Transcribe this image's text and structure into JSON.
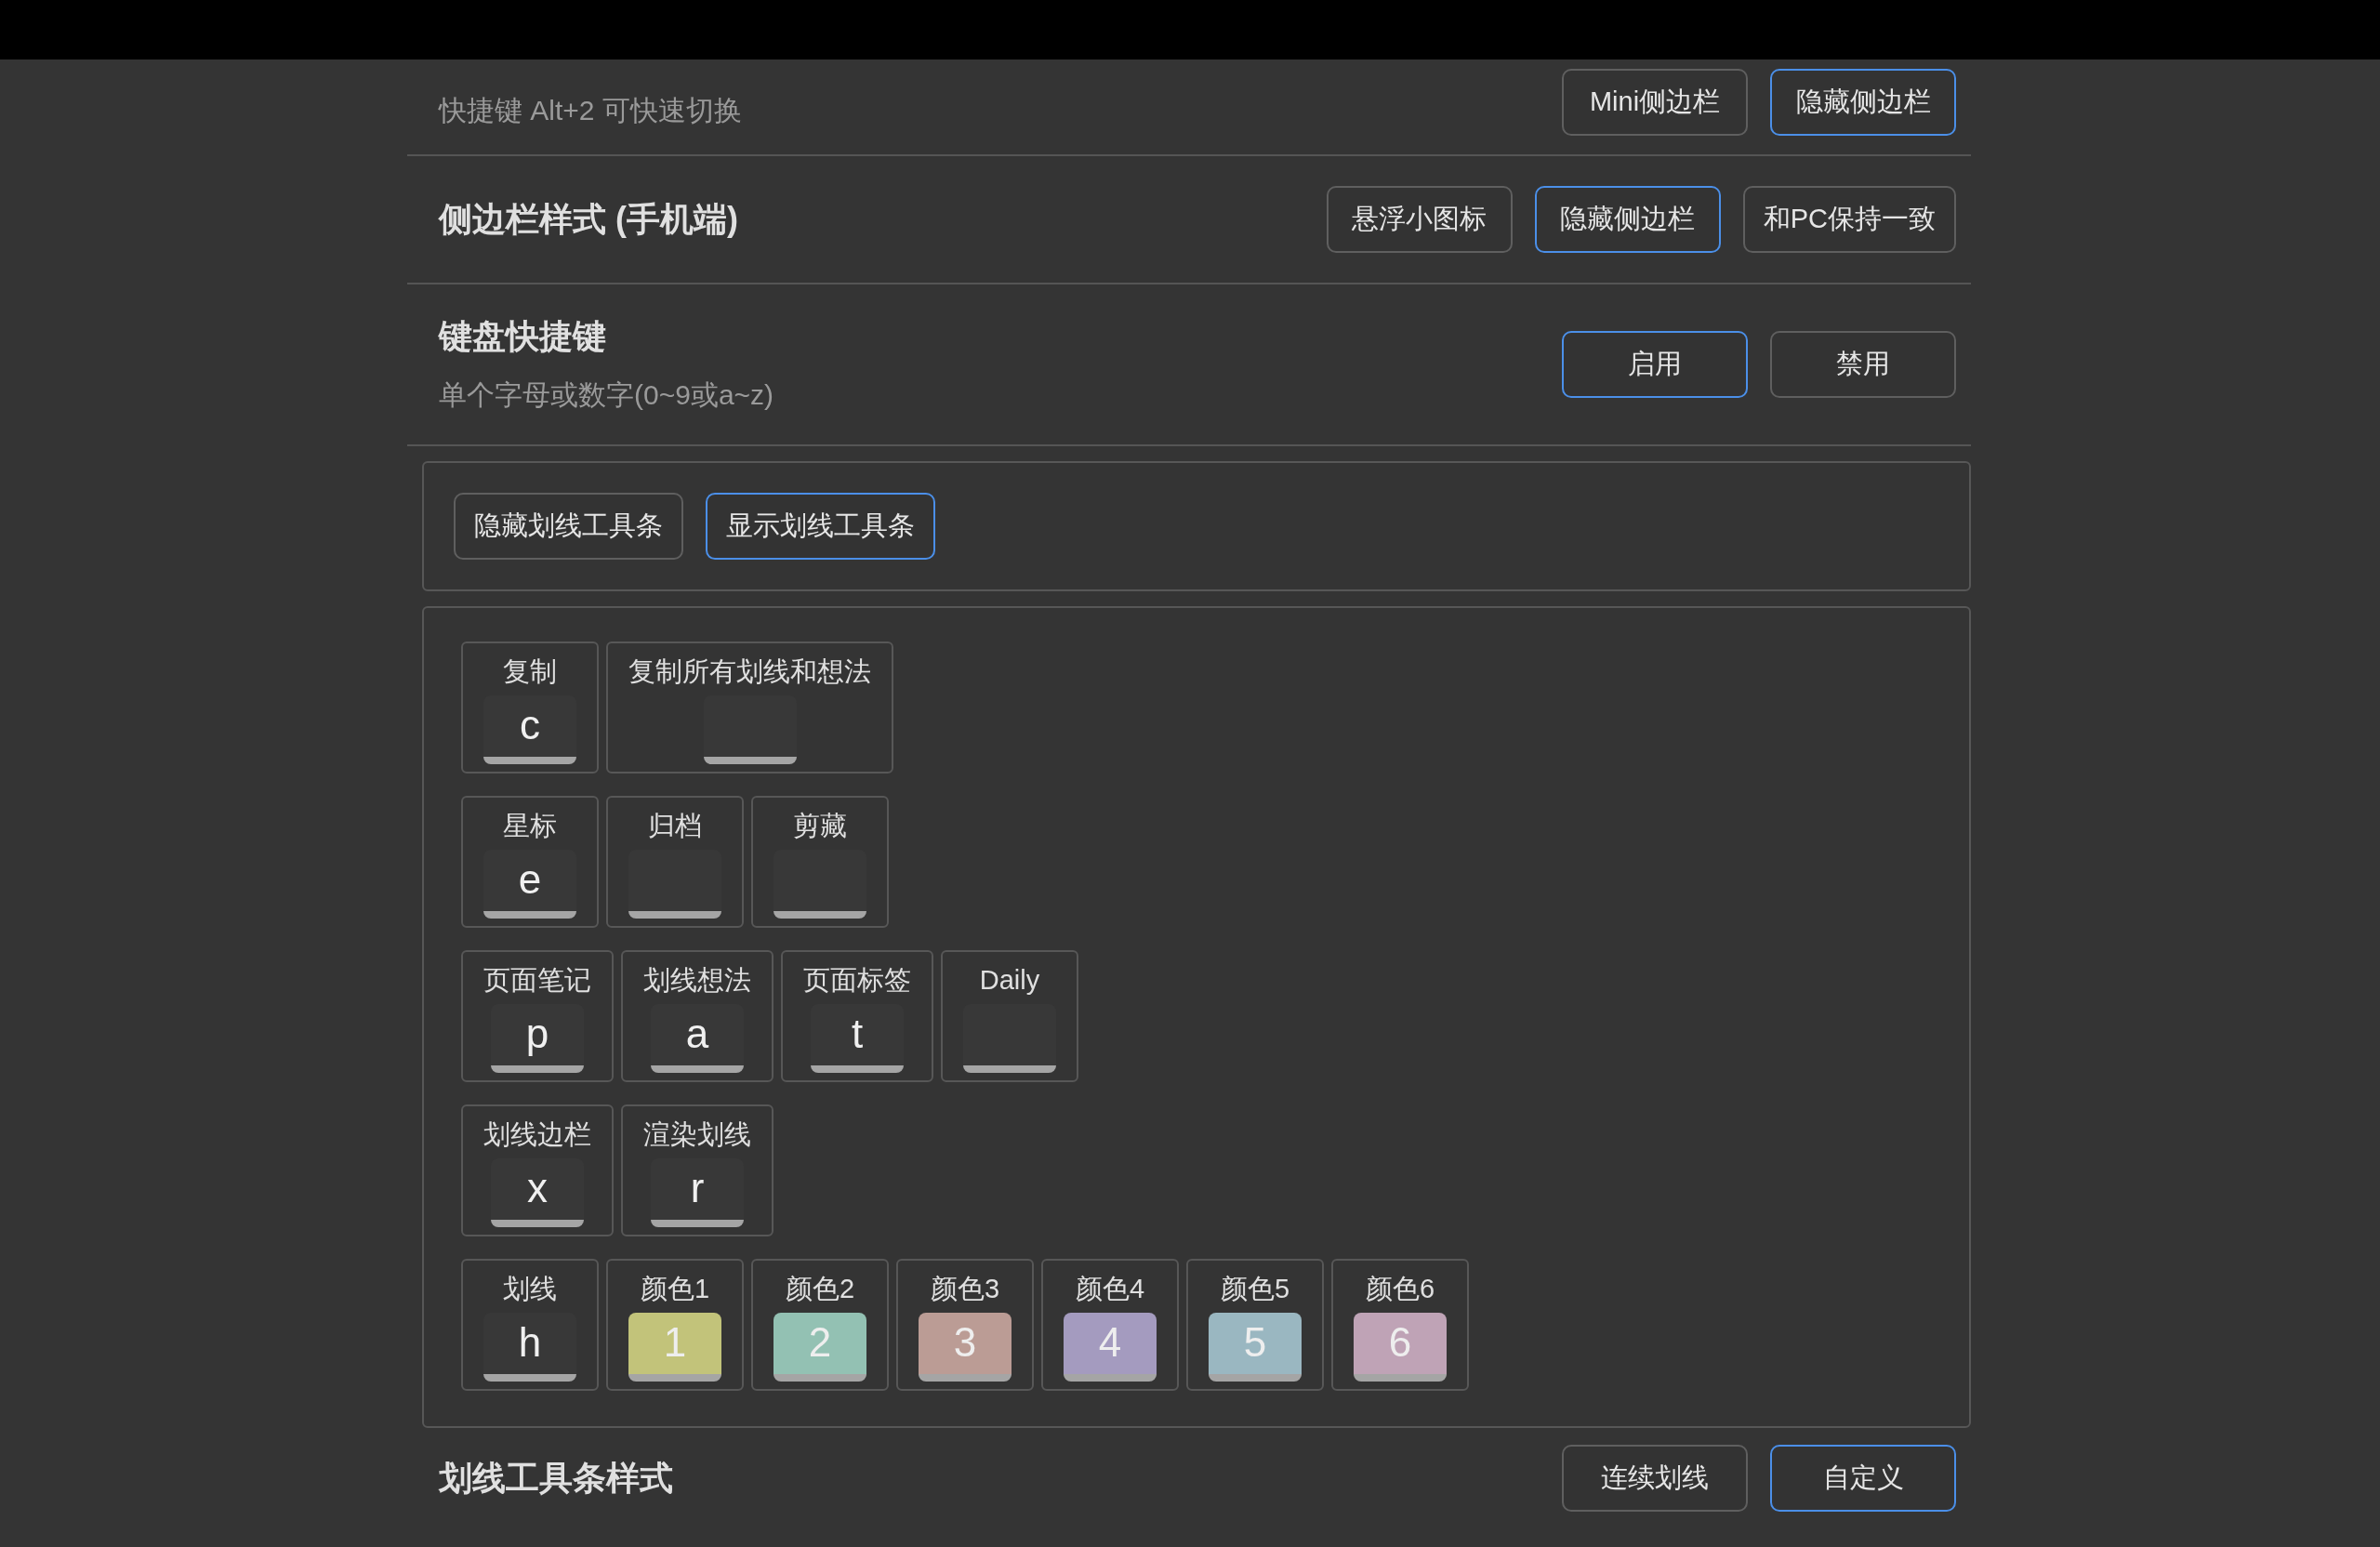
{
  "settings": [
    {
      "hint": "快捷键 Alt+2 可快速切换",
      "options": [
        {
          "label": "Mini侧边栏",
          "selected": false
        },
        {
          "label": "隐藏侧边栏",
          "selected": true
        }
      ]
    },
    {
      "title": "侧边栏样式 (手机端)",
      "options": [
        {
          "label": "悬浮小图标",
          "selected": false
        },
        {
          "label": "隐藏侧边栏",
          "selected": true
        },
        {
          "label": "和PC保持一致",
          "selected": false
        }
      ]
    },
    {
      "title": "键盘快捷键",
      "hint": "单个字母或数字(0~9或a~z)",
      "options": [
        {
          "label": "启用",
          "selected": true
        },
        {
          "label": "禁用",
          "selected": false
        }
      ]
    }
  ],
  "toolbar_toggle": {
    "options": [
      {
        "label": "隐藏划线工具条",
        "selected": false
      },
      {
        "label": "显示划线工具条",
        "selected": true
      }
    ]
  },
  "shortcut_rows": [
    [
      {
        "label": "复制",
        "key": "c"
      },
      {
        "label": "复制所有划线和想法"
      }
    ],
    [
      {
        "label": "星标",
        "key": "e"
      },
      {
        "label": "归档"
      },
      {
        "label": "剪藏"
      }
    ],
    [
      {
        "label": "页面笔记",
        "key": "p"
      },
      {
        "label": "划线想法",
        "key": "a"
      },
      {
        "label": "页面标签",
        "key": "t"
      },
      {
        "label": "Daily"
      }
    ],
    [
      {
        "label": "划线边栏",
        "key": "x"
      },
      {
        "label": "渲染划线",
        "key": "r"
      }
    ],
    [
      {
        "label": "划线",
        "key": "h"
      },
      {
        "label": "颜色1",
        "key": "1",
        "color": "#c2c37a"
      },
      {
        "label": "颜色2",
        "key": "2",
        "color": "#93c1b3"
      },
      {
        "label": "颜色3",
        "key": "3",
        "color": "#bb9c95"
      },
      {
        "label": "颜色4",
        "key": "4",
        "color": "#a49bbf"
      },
      {
        "label": "颜色5",
        "key": "5",
        "color": "#9ab7c1"
      },
      {
        "label": "颜色6",
        "key": "6",
        "color": "#bfa3b6"
      }
    ]
  ],
  "bottom_section": {
    "title": "划线工具条样式",
    "options": [
      {
        "label": "连续划线",
        "selected": false
      },
      {
        "label": "自定义",
        "selected": true
      }
    ]
  }
}
